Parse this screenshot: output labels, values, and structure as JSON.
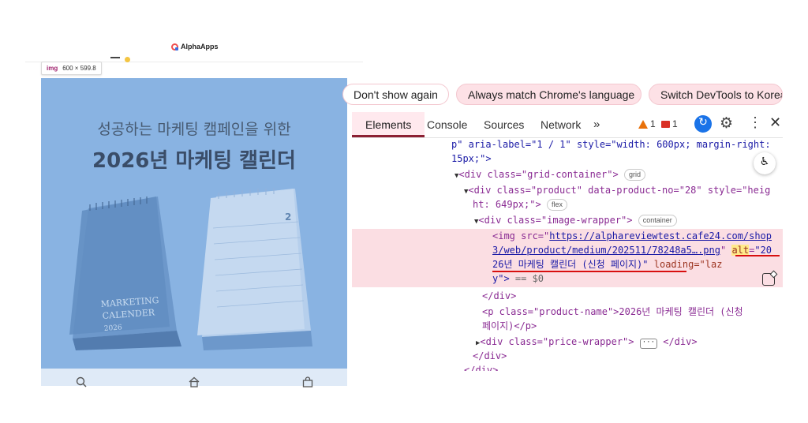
{
  "left_page": {
    "logo_text": "AlphaApps",
    "tooltip": {
      "tag": "img",
      "size": "600 × 599.8"
    },
    "product": {
      "subtitle": "성공하는 마케팅 캠페인을 위한",
      "title": "2026년 마케팅 캘린더",
      "cover_text": [
        "MARKETING",
        "CALENDER",
        "2026"
      ],
      "month_number": "2"
    },
    "bottom_nav": [
      "search-icon",
      "home-icon",
      "cart-icon"
    ]
  },
  "devtools": {
    "infobar": {
      "dont_show": "Don't show again",
      "match_language": "Always match Chrome's language",
      "switch_korean": "Switch DevTools to Korea"
    },
    "tabs": [
      "Elements",
      "Console",
      "Sources",
      "Network"
    ],
    "more_tabs": "»",
    "warnings": "1",
    "messages": "1",
    "code": {
      "l1_start": "p\" aria-label=\"1 / 1\" style=\"width: 600px; margin-right: ",
      "l2": "15px;\">",
      "grid_div": "<div class=\"grid-container\">",
      "grid_badge": "grid",
      "product_div": "<div class=\"product\" data-product-no=\"28\" style=\"heig",
      "product_div2": "ht: 649px;\">",
      "flex_badge": "flex",
      "wrapper_div": "<div class=\"image-wrapper\">",
      "container_badge": "container",
      "img_src_pre": "<img src=\"",
      "img_url_1": "https://alphareviewtest.cafe24.com/shop",
      "img_url_2": "3/web/product/medium/202511/78248a5….png",
      "img_alt_attr": "alt",
      "img_alt_start": "\"20",
      "img_alt_rest": "26년 마케팅 캘린더 (신청 페이지)\"",
      "img_loading": " loading=\"laz",
      "img_end": "y\">",
      "eq": " == $0",
      "close_div": "</div>",
      "p_line": "<p class=\"product-name\">2026년 마케팅 캘린더 (신청",
      "p_line2": "페이지)</p>",
      "price_div": "<div class=\"price-wrapper\">",
      "price_close": "</div>",
      "close_div2": "</div>",
      "close_div3": "</div>"
    }
  },
  "colors": {
    "product_bg": "#8fb6e3",
    "highlight_row": "#fbdee3",
    "active_tab_underline": "#8c2033",
    "pill_bg": "#fde1e6",
    "sync_button": "#1a73e8",
    "alt_underline": "#d80f0f"
  }
}
